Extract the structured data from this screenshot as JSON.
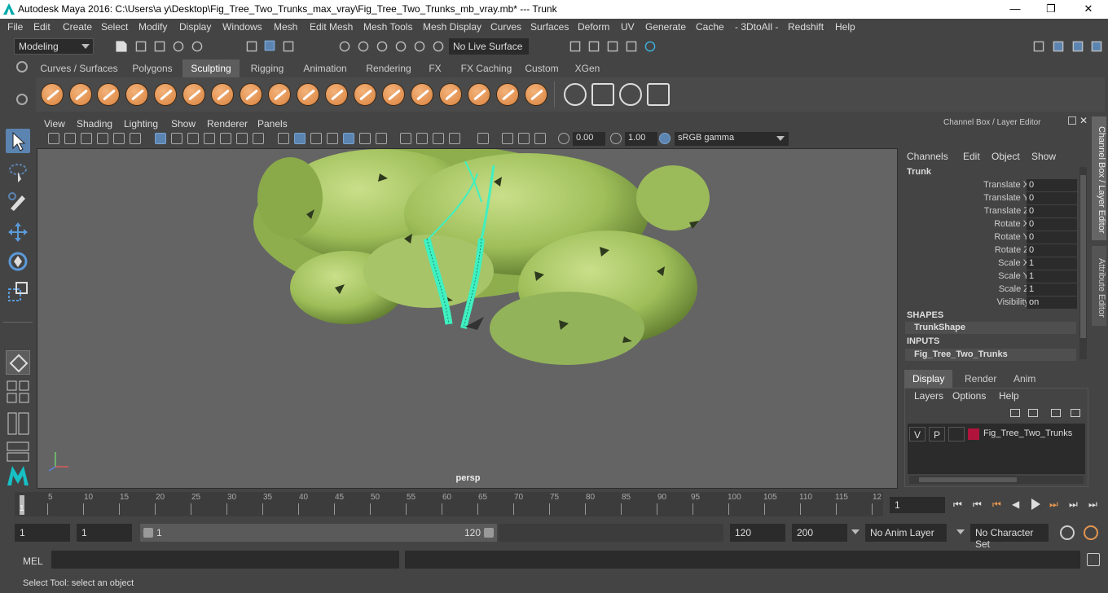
{
  "window": {
    "title": "Autodesk Maya 2016: C:\\Users\\a y\\Desktop\\Fig_Tree_Two_Trunks_max_vray\\Fig_Tree_Two_Trunks_mb_vray.mb*   ---   Trunk",
    "minimize": "—",
    "maximize": "❐",
    "close": "✕"
  },
  "menubar": [
    "File",
    "Edit",
    "Create",
    "Select",
    "Modify",
    "Display",
    "Windows",
    "Mesh",
    "Edit Mesh",
    "Mesh Tools",
    "Mesh Display",
    "Curves",
    "Surfaces",
    "Deform",
    "UV",
    "Generate",
    "Cache",
    "- 3DtoAll -",
    "Redshift",
    "Help"
  ],
  "statusline": {
    "mode": "Modeling",
    "live_surface": "No Live Surface"
  },
  "shelf_tabs": [
    "Curves / Surfaces",
    "Polygons",
    "Sculpting",
    "Rigging",
    "Animation",
    "Rendering",
    "FX",
    "FX Caching",
    "Custom",
    "XGen"
  ],
  "active_shelf": "Sculpting",
  "viewport": {
    "menus": [
      "View",
      "Shading",
      "Lighting",
      "Show",
      "Renderer",
      "Panels"
    ],
    "exposure": "0.00",
    "gamma": "1.00",
    "color_space": "sRGB gamma",
    "camera_label": "persp"
  },
  "channel_box": {
    "header": "Channel Box / Layer Editor",
    "menus": [
      "Channels",
      "Edit",
      "Object",
      "Show"
    ],
    "object_name": "Trunk",
    "attributes": [
      {
        "name": "Translate X",
        "value": "0"
      },
      {
        "name": "Translate Y",
        "value": "0"
      },
      {
        "name": "Translate Z",
        "value": "0"
      },
      {
        "name": "Rotate X",
        "value": "0"
      },
      {
        "name": "Rotate Y",
        "value": "0"
      },
      {
        "name": "Rotate Z",
        "value": "0"
      },
      {
        "name": "Scale X",
        "value": "1"
      },
      {
        "name": "Scale Y",
        "value": "1"
      },
      {
        "name": "Scale Z",
        "value": "1"
      },
      {
        "name": "Visibility",
        "value": "on"
      }
    ],
    "shapes_label": "SHAPES",
    "shape_name": "TrunkShape",
    "inputs_label": "INPUTS",
    "input_name": "Fig_Tree_Two_Trunks"
  },
  "side_tabs": [
    "Channel Box / Layer Editor",
    "Attribute Editor"
  ],
  "layer_editor": {
    "tabs": [
      "Display",
      "Render",
      "Anim"
    ],
    "menus": [
      "Layers",
      "Options",
      "Help"
    ],
    "layer": {
      "v": "V",
      "p": "P",
      "name": "Fig_Tree_Two_Trunks",
      "color": "#b0143c"
    }
  },
  "timeline": {
    "ticks": [
      "5",
      "10",
      "15",
      "20",
      "25",
      "30",
      "35",
      "40",
      "45",
      "50",
      "55",
      "60",
      "65",
      "70",
      "75",
      "80",
      "85",
      "90",
      "95",
      "100",
      "105",
      "110",
      "115",
      "12"
    ],
    "current_frame_marker": "1",
    "current_frame": "1"
  },
  "range": {
    "start": "1",
    "playback_start": "1",
    "slider_start": "1",
    "slider_end": "120",
    "playback_end": "120",
    "end": "200",
    "anim_layer": "No Anim Layer",
    "character_set": "No Character Set"
  },
  "mel": {
    "label": "MEL"
  },
  "help_line": "Select Tool: select an object",
  "colors": {
    "accent": "#5b84b1",
    "sculpt_orange": "#e39550",
    "wire_highlight": "#3ff0c0"
  }
}
